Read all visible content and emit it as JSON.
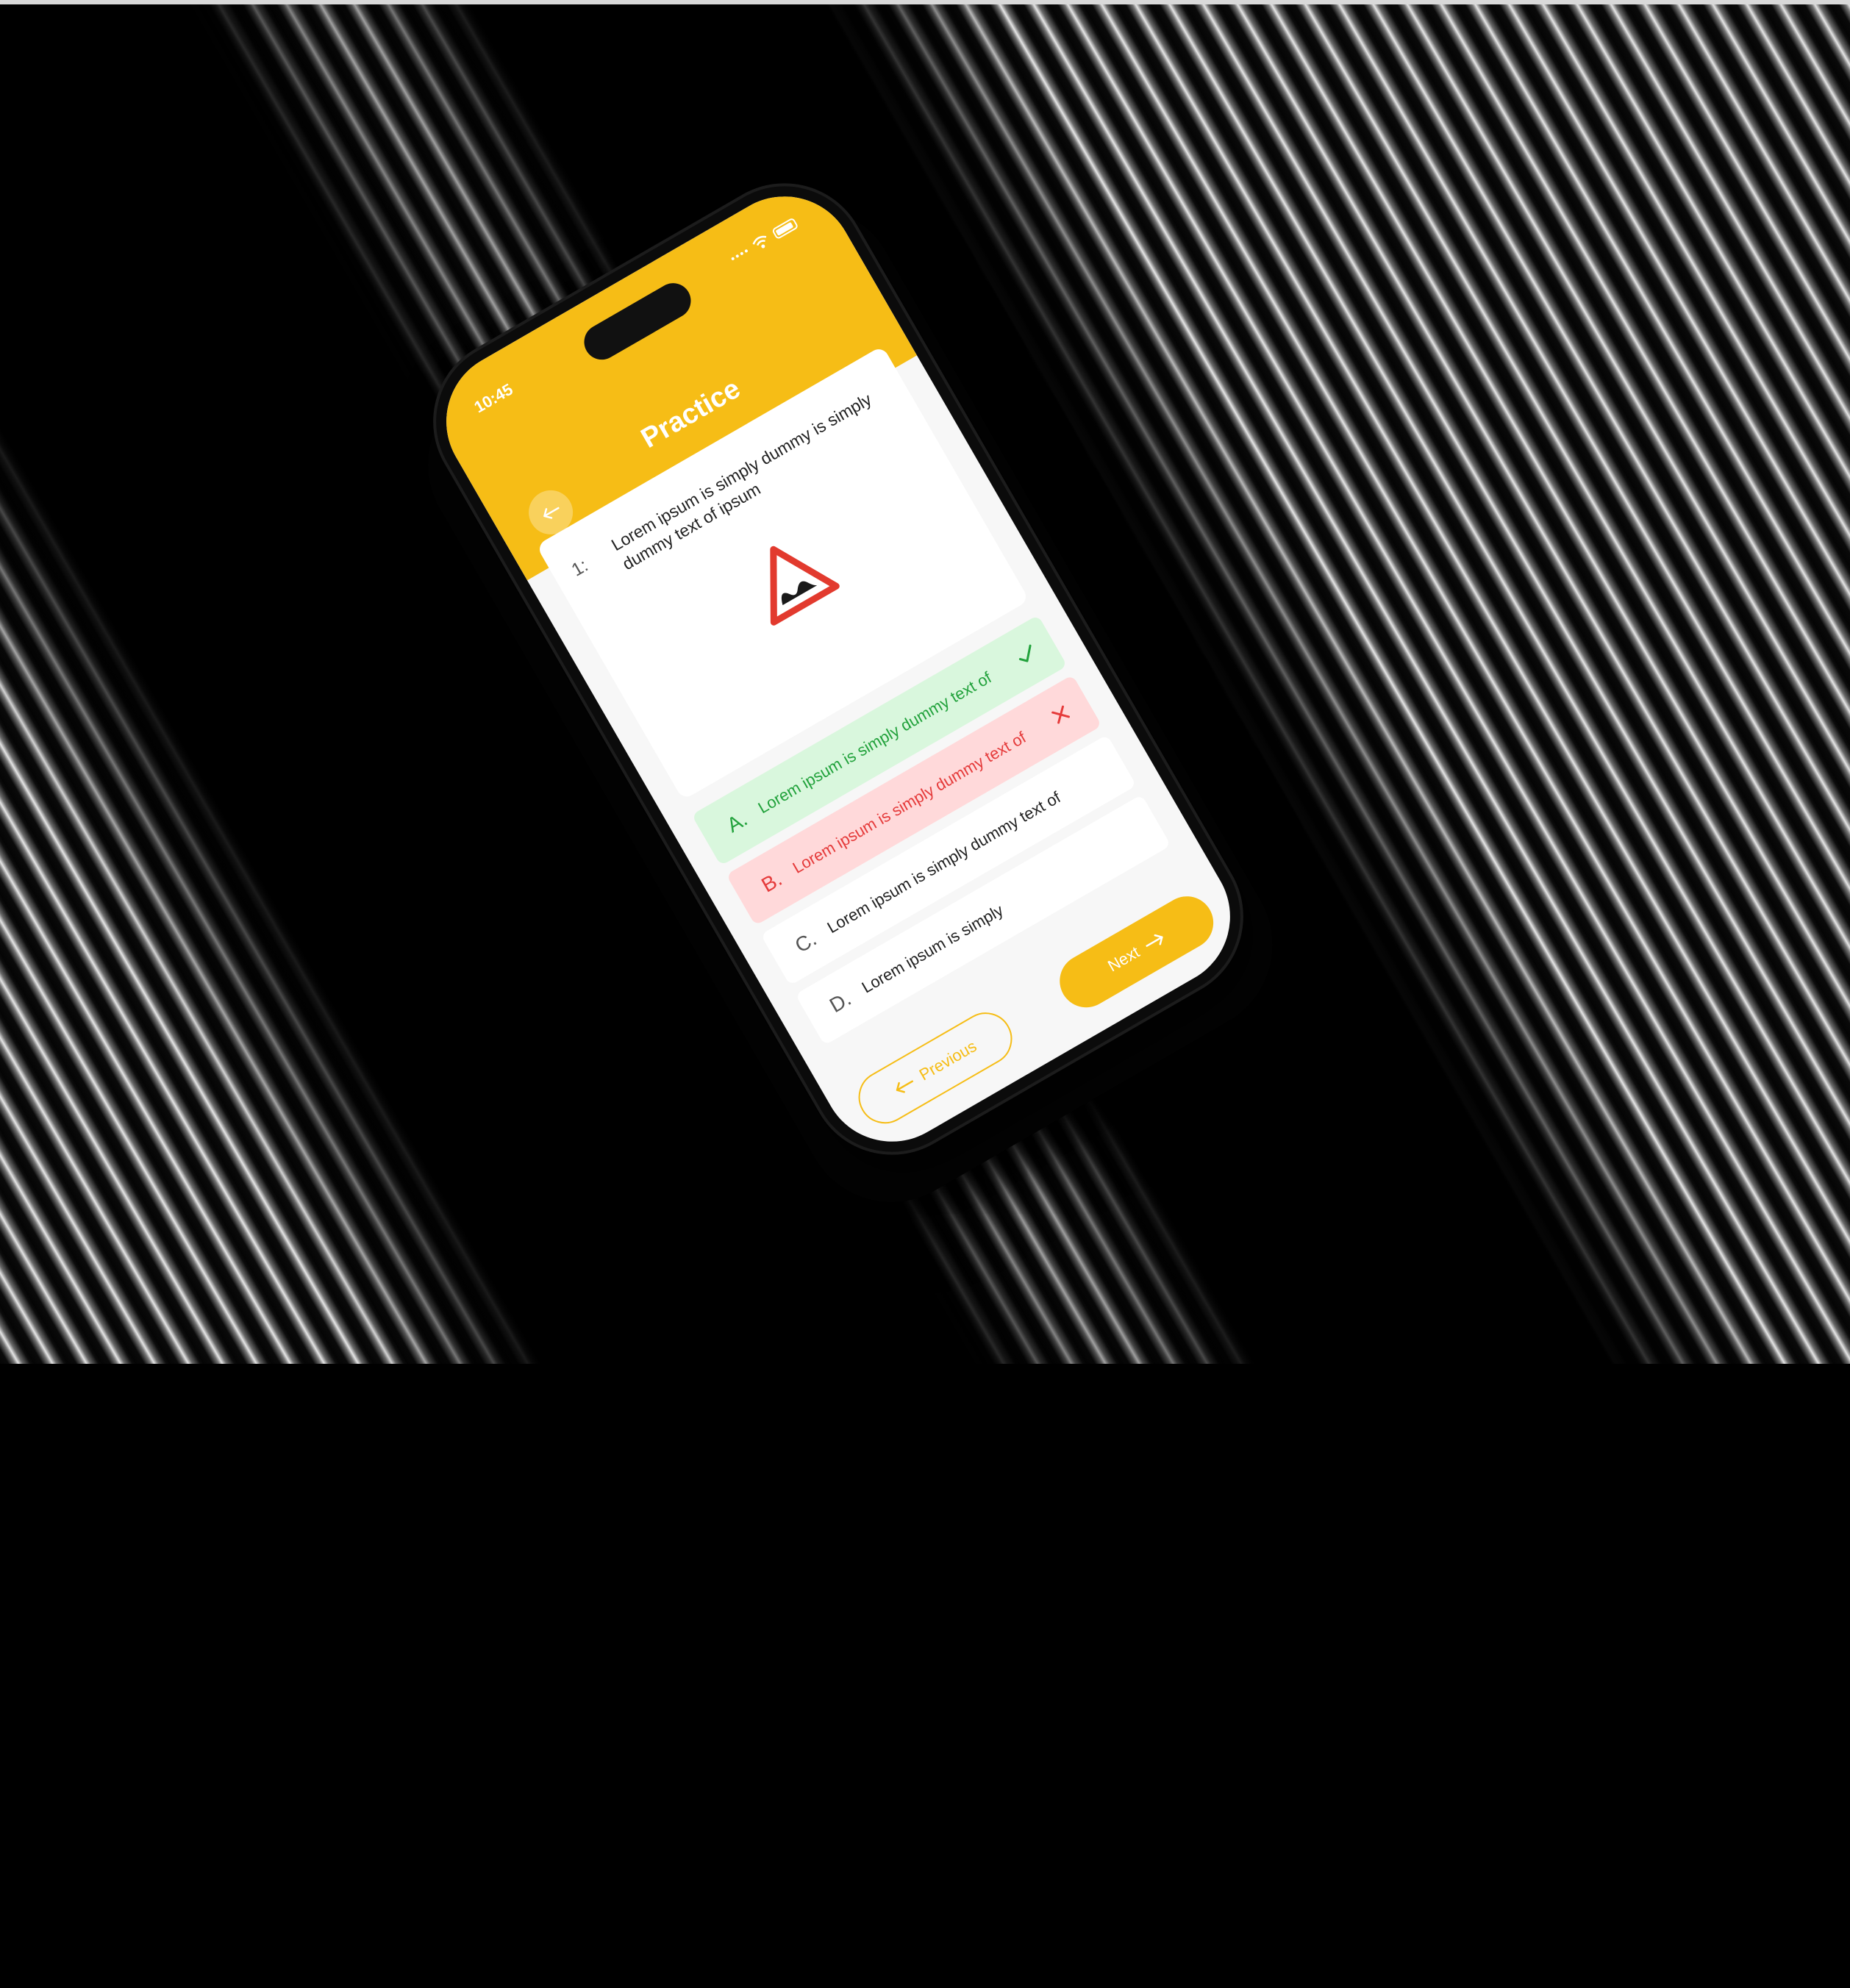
{
  "status_bar": {
    "time": "10:45"
  },
  "header": {
    "title": "Practice"
  },
  "question": {
    "number": "1:",
    "text": "Lorem ipsum is simply dummy is simply dummy text of ipsum",
    "sign_icon": "uneven-road-warning-sign-icon"
  },
  "options": [
    {
      "letter": "A.",
      "text": "Lorem ipsum is simply dummy text of",
      "state": "correct",
      "mark_icon": "check-icon"
    },
    {
      "letter": "B.",
      "text": "Lorem ipsum is simply dummy text of",
      "state": "wrong",
      "mark_icon": "cross-icon"
    },
    {
      "letter": "C.",
      "text": "Lorem ipsum is simply dummy text of",
      "state": "neutral"
    },
    {
      "letter": "D.",
      "text": "Lorem ipsum is simply",
      "state": "neutral"
    }
  ],
  "nav": {
    "previous_label": "Previous",
    "next_label": "Next"
  },
  "colors": {
    "accent": "#f6bd16",
    "correct_bg": "#d9f7dd",
    "correct_fg": "#22a23c",
    "wrong_bg": "#ffd9da",
    "wrong_fg": "#e53b3b"
  }
}
